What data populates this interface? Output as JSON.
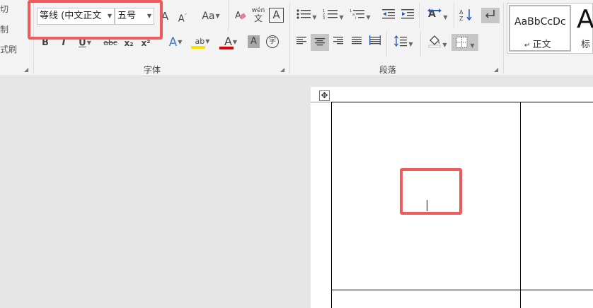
{
  "clipboard": {
    "cut_label": "剪切",
    "copy_label": "复制",
    "format_painter_label": "格式刷"
  },
  "font": {
    "group_label": "字体",
    "font_name": "等线 (中文正文",
    "font_size": "五号",
    "grow_glyph": "A",
    "shrink_glyph": "A",
    "change_case_label": "Aa",
    "phonetic_top": "wén",
    "phonetic_bottom": "文",
    "char_border_glyph": "A",
    "bold": "B",
    "italic": "I",
    "underline": "U",
    "strike": "abc",
    "subscript": "x₂",
    "superscript": "x²",
    "text_effects": "A",
    "highlight": "ab",
    "font_color": "A",
    "char_shading": "A",
    "enclose_char": "字",
    "highlight_color": "#f5e400",
    "font_color_value": "#e00000"
  },
  "paragraph": {
    "group_label": "段落"
  },
  "styles": {
    "normal_preview": "AaBbCcDc",
    "normal_label": "正文",
    "heading_preview": "A",
    "heading_label": "标"
  },
  "colors": {
    "highlight_box": "#ef5a5a"
  }
}
